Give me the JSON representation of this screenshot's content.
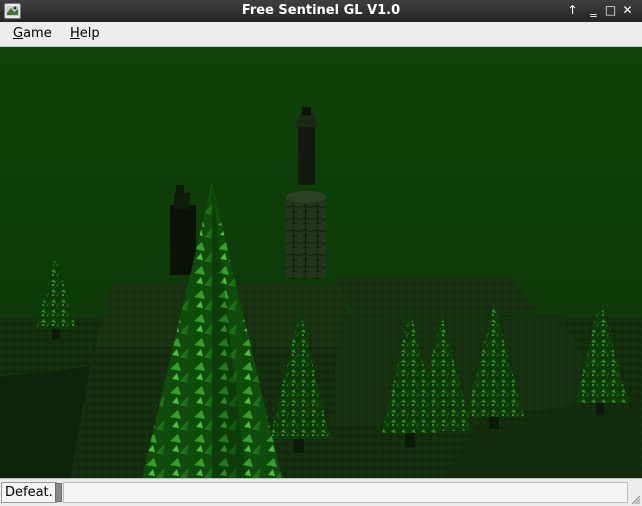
{
  "window": {
    "title": "Free Sentinel GL V1.0",
    "icons": {
      "app": "sentinel-app-icon",
      "shade": "arrow-up-icon",
      "minimize": "minimize-icon",
      "maximize": "maximize-icon",
      "close": "close-icon"
    },
    "glyphs": {
      "shade": "↑",
      "minimize": "‗",
      "maximize": "□",
      "close": "✕"
    }
  },
  "menubar": {
    "items": [
      {
        "mnemonic": "G",
        "rest": "ame"
      },
      {
        "mnemonic": "H",
        "rest": "elp"
      }
    ]
  },
  "scene": {
    "sky_color": "#0e3f08",
    "ground_color": "#0b2a06",
    "objects": [
      "sentinel",
      "sentry",
      "player-robot",
      "trees",
      "boulders"
    ]
  },
  "status": {
    "message": "Defeat.",
    "field_value": ""
  }
}
